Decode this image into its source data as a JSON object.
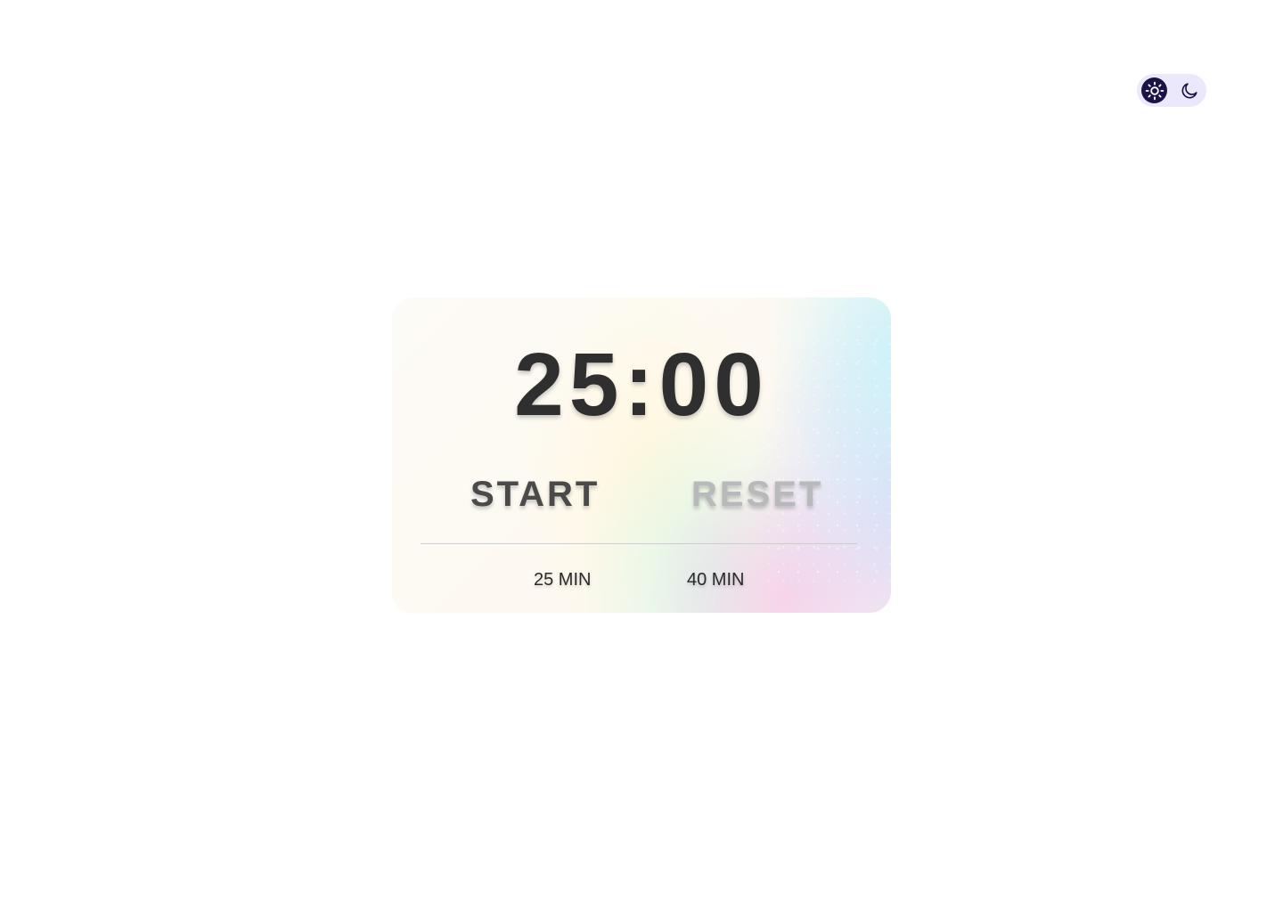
{
  "theme_toggle": {
    "options": [
      {
        "icon": "sun-icon",
        "selected": true
      },
      {
        "icon": "moon-icon",
        "selected": false
      }
    ],
    "colors": {
      "track": "#ece8fb",
      "active_bg": "#1b1346"
    }
  },
  "timer": {
    "display": "25:00",
    "start_label": "START",
    "reset_label": "RESET",
    "presets": [
      "25 MIN",
      "40 MIN"
    ]
  },
  "colors": {
    "timer_text": "#2f2f2f",
    "start_text": "#4a4a4a",
    "reset_text_disabled": "#b7b9bb"
  }
}
